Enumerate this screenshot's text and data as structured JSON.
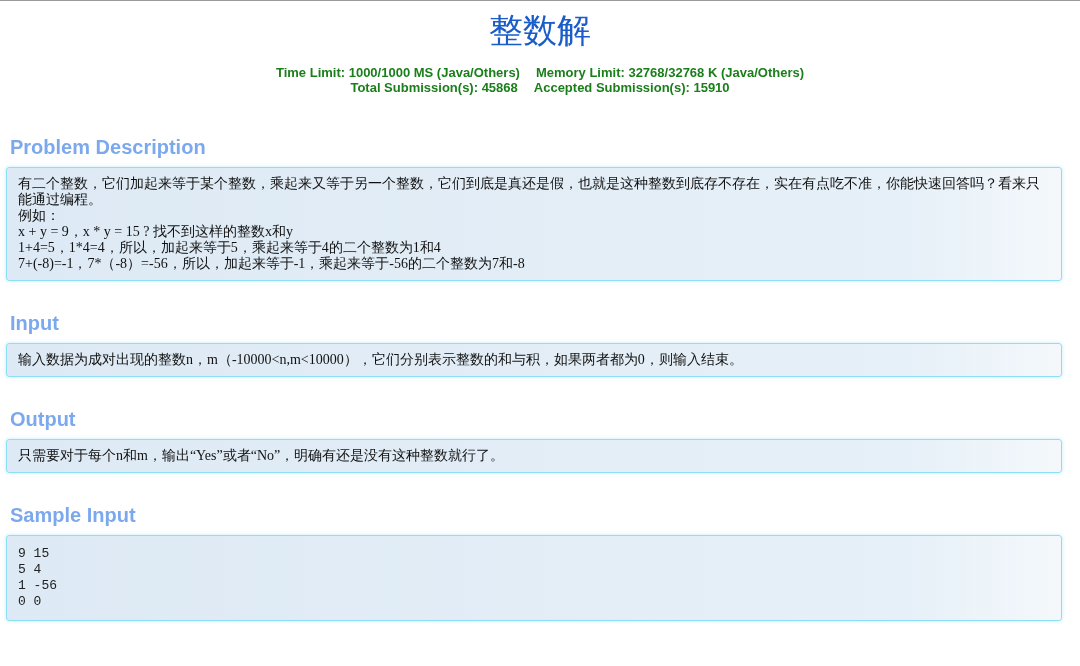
{
  "title": "整数解",
  "limits": [
    "Time Limit: 1000/1000 MS (Java/Others)",
    "Memory Limit: 32768/32768 K (Java/Others)"
  ],
  "submissions": [
    "Total Submission(s): 45868",
    "Accepted Submission(s): 15910"
  ],
  "sections": [
    {
      "kind": "text",
      "heading": "Problem Description",
      "lines": [
        "有二个整数，它们加起来等于某个整数，乘起来又等于另一个整数，它们到底是真还是假，也就是这种整数到底存不存在，实在有点吃不准，你能快速回答吗？看来只能通过编程。",
        "例如：",
        "x + y = 9，x * y = 15 ? 找不到这样的整数x和y",
        "1+4=5，1*4=4，所以，加起来等于5，乘起来等于4的二个整数为1和4",
        "7+(-8)=-1，7*（-8）=-56，所以，加起来等于-1，乘起来等于-56的二个整数为7和-8"
      ]
    },
    {
      "kind": "text",
      "heading": "Input",
      "lines": [
        "输入数据为成对出现的整数n，m（-10000<n,m<10000），它们分别表示整数的和与积，如果两者都为0，则输入结束。"
      ]
    },
    {
      "kind": "text",
      "heading": "Output",
      "lines": [
        "只需要对于每个n和m，输出“Yes”或者“No”，明确有还是没有这种整数就行了。"
      ]
    },
    {
      "kind": "code",
      "heading": "Sample Input",
      "lines": [
        "9 15",
        "5 4",
        "1 -56",
        "0 0"
      ]
    }
  ]
}
